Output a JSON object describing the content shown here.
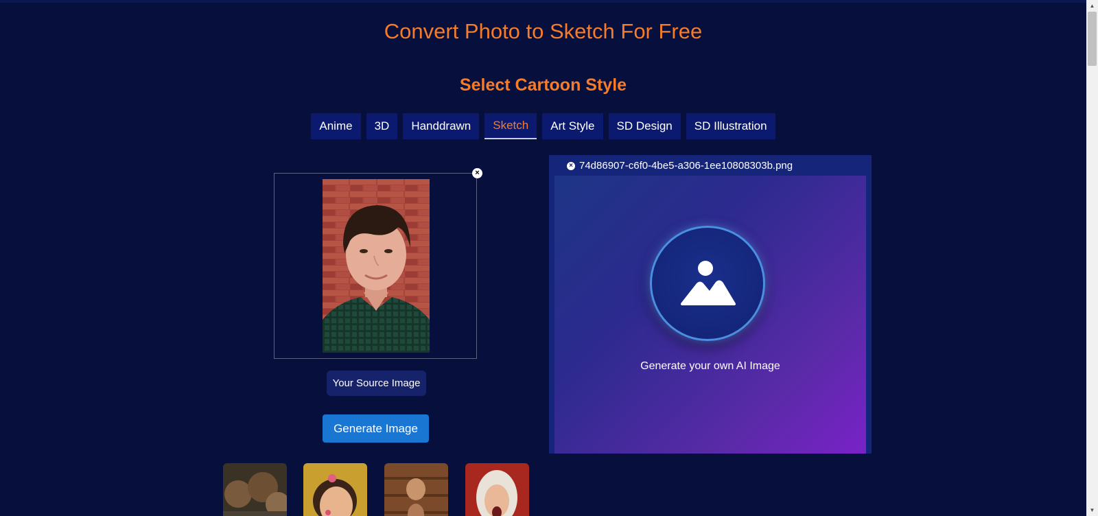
{
  "header": {
    "title": "Convert Photo to Sketch For Free",
    "subtitle": "Select Cartoon Style"
  },
  "styles": {
    "tabs": [
      {
        "label": "Anime"
      },
      {
        "label": "3D"
      },
      {
        "label": "Handdrawn"
      },
      {
        "label": "Sketch",
        "active": true
      },
      {
        "label": "Art Style"
      },
      {
        "label": "SD Design"
      },
      {
        "label": "SD Illustration"
      }
    ]
  },
  "source": {
    "close_symbol": "×",
    "label": "Your Source Image",
    "generate_label": "Generate Image"
  },
  "result": {
    "filename": "74d86907-c6f0-4be5-a306-1ee10808303b.png",
    "remove_symbol": "×",
    "placeholder_text": "Generate your own AI Image",
    "placeholder_icon": "image-icon"
  },
  "examples": {
    "thumbnails": [
      "example-thumbnail-1",
      "example-thumbnail-2",
      "example-thumbnail-3",
      "example-thumbnail-4"
    ]
  },
  "colors": {
    "background": "#070f3d",
    "accent": "#f47c2a",
    "tab_bg": "#0b1a6e",
    "button_blue": "#1976d2",
    "gradient_end": "#7a22c8"
  },
  "scrollbar": {
    "up_symbol": "▲",
    "down_symbol": "▼"
  }
}
